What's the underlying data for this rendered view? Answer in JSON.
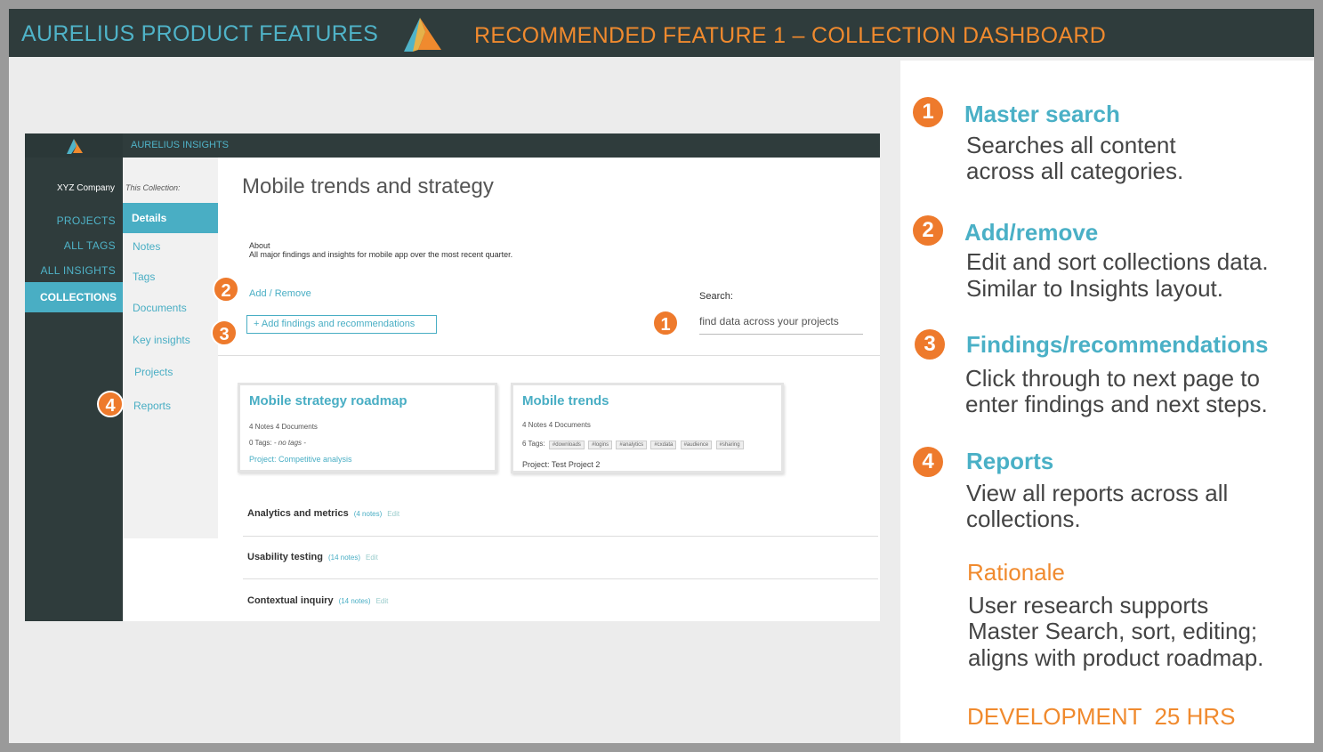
{
  "header": {
    "brand": "AURELIUS PRODUCT FEATURES",
    "feature_title": "RECOMMENDED FEATURE 1 – COLLECTION DASHBOARD"
  },
  "app": {
    "app_name": "AURELIUS INSIGHTS",
    "company": "XYZ Company",
    "nav": {
      "projects": "PROJECTS",
      "all_tags": "ALL TAGS",
      "all_insights": "ALL INSIGHTS",
      "collections": "COLLECTIONS"
    },
    "subnav": {
      "this_collection": "This Collection:",
      "details": "Details",
      "notes": "Notes",
      "tags": "Tags",
      "documents": "Documents",
      "key_insights": "Key insights",
      "projects": "Projects",
      "reports": "Reports"
    },
    "main": {
      "title": "Mobile trends and strategy",
      "about_label": "About",
      "about_text": "All major findings and insights for mobile app over the most recent quarter.",
      "add_remove": "Add / Remove",
      "add_findings": "+ Add findings and recommendations",
      "search_label": "Search:",
      "search_placeholder": "find data across your projects"
    },
    "cards": [
      {
        "title": "Mobile strategy roadmap",
        "counts": "4 Notes   4 Documents",
        "tags_label": "0 Tags:",
        "tags_empty": "- no tags -",
        "project": "Project: Competitive analysis"
      },
      {
        "title": "Mobile trends",
        "counts": "4 Notes   4 Documents",
        "tags_label": "6 Tags:",
        "tags": [
          "#downloads",
          "#logins",
          "#analytics",
          "#cxdata",
          "#audience",
          "#sharing"
        ],
        "project": "Project: Test Project 2"
      }
    ],
    "rows": [
      {
        "name": "Analytics and metrics",
        "notes": "(4 notes)",
        "edit": "Edit"
      },
      {
        "name": "Usability testing",
        "notes": "(14 notes)",
        "edit": "Edit"
      },
      {
        "name": "Contextual inquiry",
        "notes": "(14 notes)",
        "edit": "Edit"
      }
    ],
    "badges": [
      "1",
      "2",
      "3",
      "4"
    ]
  },
  "features": [
    {
      "num": "1",
      "title": "Master search",
      "desc1": "Searches all content",
      "desc2": "across all categories."
    },
    {
      "num": "2",
      "title": "Add/remove",
      "desc1": "Edit and sort collections data.",
      "desc2": "Similar to Insights layout."
    },
    {
      "num": "3",
      "title": "Findings/recommendations",
      "desc1": "Click through to next page to",
      "desc2": "enter findings and next steps."
    },
    {
      "num": "4",
      "title": "Reports",
      "desc1": "View all reports across all",
      "desc2": "collections."
    }
  ],
  "rationale": {
    "title": "Rationale",
    "line1": "User research supports",
    "line2": "Master Search, sort, editing;",
    "line3": "aligns with product roadmap."
  },
  "development": "DEVELOPMENT  25 HRS",
  "colors": {
    "header_bg": "#2f3c3c",
    "teal": "#4fb3c8",
    "orange": "#f08a2e"
  }
}
